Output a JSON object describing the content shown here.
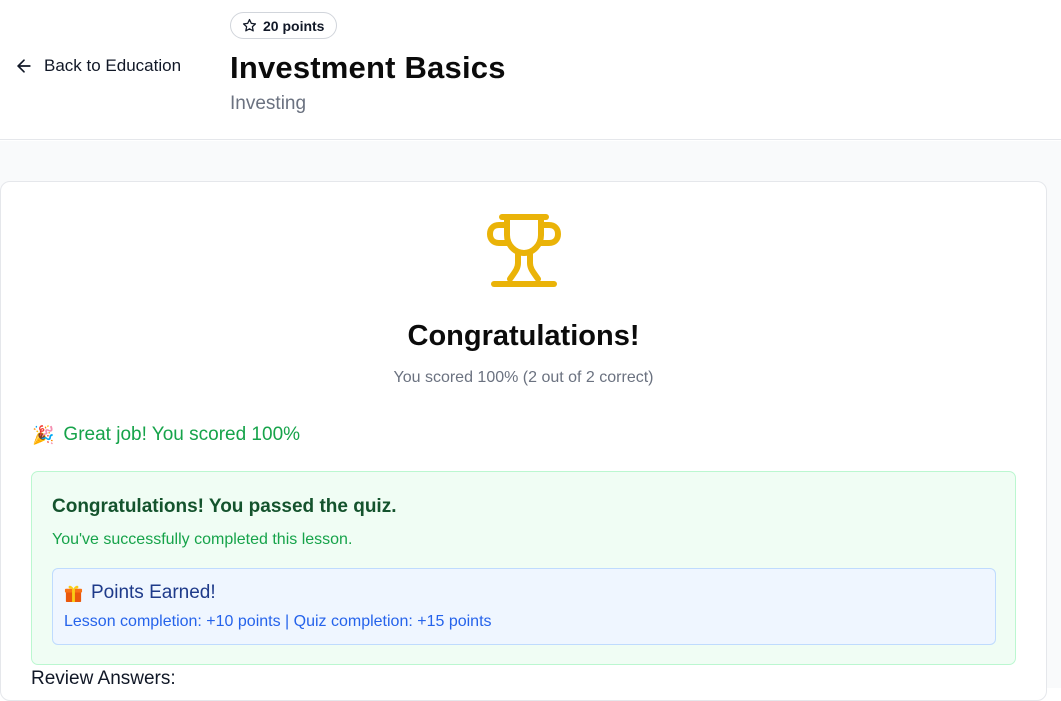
{
  "header": {
    "back_label": "Back to Education",
    "points_badge": "20 points",
    "title": "Investment Basics",
    "category": "Investing"
  },
  "result": {
    "heading": "Congratulations!",
    "score_text": "You scored 100% (2 out of 2 correct)",
    "great_job_emoji": "🎉",
    "great_job_text": "Great job! You scored 100%"
  },
  "pass_box": {
    "title": "Congratulations! You passed the quiz.",
    "subtitle": "You've successfully completed this lesson."
  },
  "points_earned": {
    "title": "Points Earned!",
    "detail": "Lesson completion: +10 points | Quiz completion: +15 points"
  },
  "review": {
    "heading": "Review Answers:"
  },
  "colors": {
    "trophy": "#eab308",
    "success_green": "#16a34a",
    "success_bg": "#f0fdf4",
    "info_blue": "#2563eb",
    "info_bg": "#eff6ff"
  },
  "icons": {
    "back": "arrow-left-icon",
    "points": "star-icon",
    "trophy": "trophy-icon",
    "celebrate": "party-popper-icon",
    "gift": "gift-icon"
  }
}
